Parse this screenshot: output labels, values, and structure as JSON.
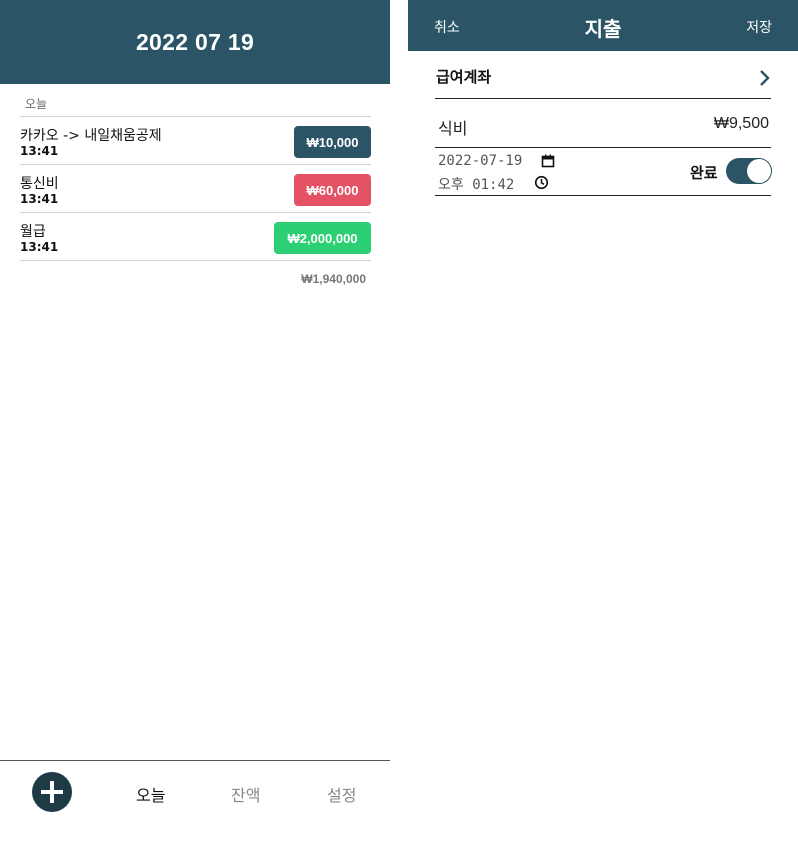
{
  "colors": {
    "header": "#2b5566",
    "transfer_badge": "#2b5566",
    "expense_badge": "#e45365",
    "income_badge": "#2ccf73"
  },
  "left": {
    "header_date": "2022 07 19",
    "section_label": "오늘",
    "transactions": [
      {
        "title": "카카오 -> 내일채움공제",
        "time": "13:41",
        "amount": "₩10,000",
        "type": "transfer"
      },
      {
        "title": "통신비",
        "time": "13:41",
        "amount": "₩60,000",
        "type": "expense"
      },
      {
        "title": "월급",
        "time": "13:41",
        "amount": "₩2,000,000",
        "type": "income"
      }
    ],
    "total": "₩1,940,000",
    "nav": {
      "add_icon": "plus-circle-icon",
      "today": "오늘",
      "balance": "잔액",
      "settings": "설정"
    }
  },
  "right": {
    "cancel_label": "취소",
    "title": "지출",
    "save_label": "저장",
    "account": "급여계좌",
    "category": "식비",
    "amount": "₩9,500",
    "date": "2022-07-19",
    "time": "오후 01:42",
    "done_label": "완료",
    "done_toggle": true
  }
}
